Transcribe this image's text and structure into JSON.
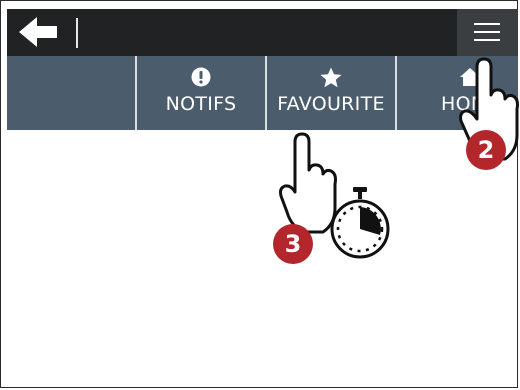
{
  "topbar": {
    "back_icon": "arrow-left-icon",
    "menu_icon": "hamburger-menu-icon"
  },
  "tabs": [
    {
      "icon": "exclamation-circle-icon",
      "label": "NOTIFS"
    },
    {
      "icon": "star-icon",
      "label": "FAVOURITE"
    },
    {
      "icon": "home-icon",
      "label": "HOME"
    }
  ],
  "annotations": {
    "step_menu": "2",
    "step_favourite": "3",
    "gesture_menu": "tap-hand-icon",
    "gesture_favourite": "long-press-hand-icon",
    "timer_icon": "stopwatch-icon",
    "badge_color": "#b3262b"
  },
  "colors": {
    "topbar": "#202224",
    "menu_button": "#3b3e41",
    "tabbar": "#4b5d6d"
  }
}
